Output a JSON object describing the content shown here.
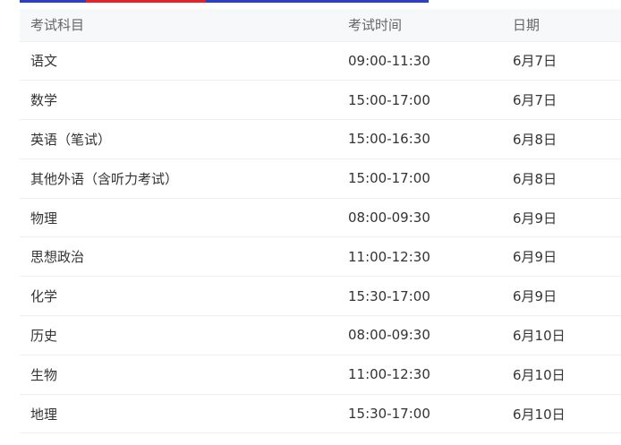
{
  "table": {
    "headers": {
      "subject": "考试科目",
      "time": "考试时间",
      "date": "日期"
    },
    "rows": [
      {
        "subject": "语文",
        "time": "09:00-11:30",
        "date": "6月7日"
      },
      {
        "subject": "数学",
        "time": "15:00-17:00",
        "date": "6月7日"
      },
      {
        "subject": "英语（笔试）",
        "time": "15:00-16:30",
        "date": "6月8日"
      },
      {
        "subject": "其他外语（含听力考试）",
        "time": "15:00-17:00",
        "date": "6月8日"
      },
      {
        "subject": "物理",
        "time": "08:00-09:30",
        "date": "6月9日"
      },
      {
        "subject": "思想政治",
        "time": "11:00-12:30",
        "date": "6月9日"
      },
      {
        "subject": "化学",
        "time": "15:30-17:00",
        "date": "6月9日"
      },
      {
        "subject": "历史",
        "time": "08:00-09:30",
        "date": "6月10日"
      },
      {
        "subject": "生物",
        "time": "11:00-12:30",
        "date": "6月10日"
      },
      {
        "subject": "地理",
        "time": "15:30-17:00",
        "date": "6月10日"
      }
    ]
  },
  "colors": {
    "header_bg": "#f7f8fa",
    "border": "#eeeeee",
    "accent_blue": "#2b3fc9",
    "accent_red": "#e8202a"
  }
}
